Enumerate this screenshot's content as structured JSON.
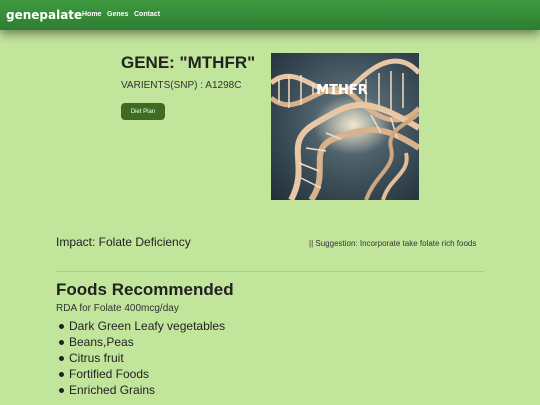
{
  "navbar": {
    "brand": "genepalate",
    "links": [
      "Home",
      "Genes",
      "Contact"
    ]
  },
  "gene": {
    "title": "GENE: \"MTHFR\"",
    "variants": "VARIENTS(SNP) : A1298C",
    "button_label": "Diet Plan",
    "image_label": "MTHFR"
  },
  "impact": {
    "text": "Impact: Folate Deficiency",
    "suggestion": "|| Suggestion: Incorporate take folate rich foods"
  },
  "foods": {
    "title": "Foods Recommended",
    "rda": "RDA for Folate 400mcg/day",
    "items": [
      "Dark Green Leafy vegetables",
      "Beans,Peas",
      "Citrus fruit",
      "Fortified Foods",
      "Enriched Grains"
    ]
  },
  "colors": {
    "background": "#c2e59c",
    "navbar": "#2e7d32",
    "button": "#3d6b22"
  }
}
